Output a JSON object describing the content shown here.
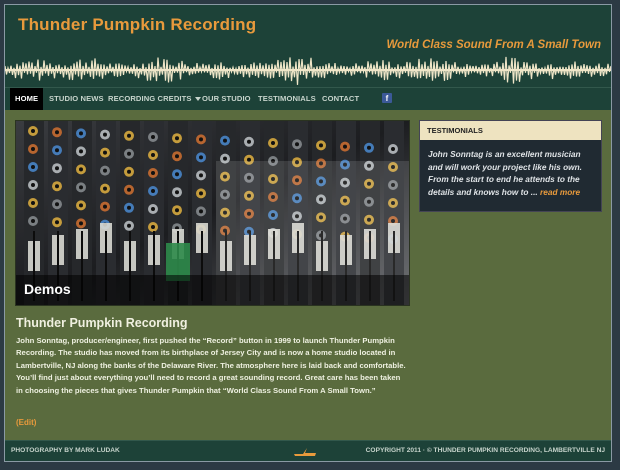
{
  "header": {
    "site_title": "Thunder Pumpkin Recording",
    "tagline": "World Class Sound From A Small Town"
  },
  "nav": {
    "items": [
      {
        "label": "HOME",
        "active": true
      },
      {
        "label": "STUDIO NEWS"
      },
      {
        "label": "RECORDING CREDITS",
        "dropdown": true
      },
      {
        "label": "OUR STUDIO"
      },
      {
        "label": "TESTIMONIALS"
      },
      {
        "label": "CONTACT"
      }
    ],
    "social_icon": "facebook-icon",
    "social_glyph": "f"
  },
  "hero": {
    "caption": "Demos"
  },
  "content": {
    "title": "Thunder Pumpkin Recording",
    "body": "John Sonntag, producer/engineer, first pushed the “Record” button in 1999 to launch Thunder Pumpkin Recording. The studio has moved from its birthplace of Jersey City and is now a home studio located in Lambertville, NJ along the banks of the Delaware River. The atmosphere here is laid back and comfortable. You’ll find just about everything you’ll need to record a great sounding record. Great care has been taken in choosing the pieces that gives Thunder Pumpkin that “World Class Sound From A Small Town.”",
    "edit_label": "(Edit)"
  },
  "sidebar": {
    "heading": "TESTIMONIALS",
    "quote": "John Sonntag is an excellent musician and will work your project like his own. From the start to end he attends to the details and knows how to ... ",
    "read_more": "read more"
  },
  "footer": {
    "left": "PHOTOGRAPHY BY MARK LUDAK",
    "right": "COPYRIGHT 2011 · © THUNDER PUMPKIN RECORDING, LAMBERTVILLE NJ"
  },
  "colors": {
    "accent": "#e89a3c",
    "header_bg": "#1d4238",
    "main_bg": "#5a6b3e",
    "sidebar_head_bg": "#eee3c0"
  }
}
